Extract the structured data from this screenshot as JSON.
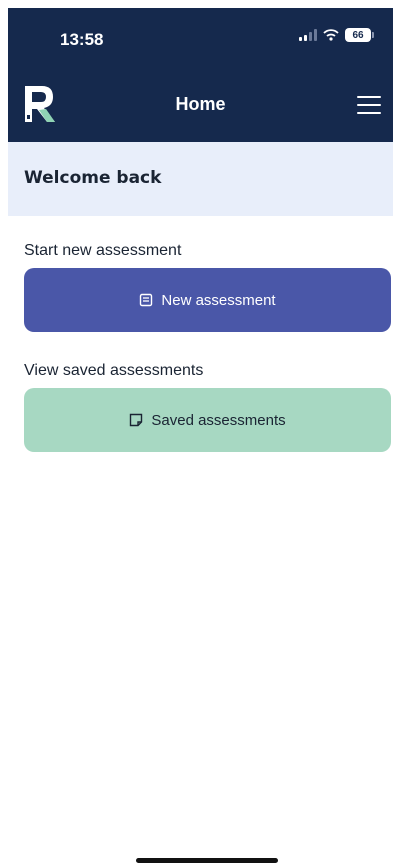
{
  "status_bar": {
    "time": "13:58",
    "battery": "66"
  },
  "header": {
    "title": "Home"
  },
  "welcome": {
    "text": "Welcome back"
  },
  "sections": {
    "new": {
      "label": "Start new assessment",
      "button_label": "New assessment"
    },
    "saved": {
      "label": "View saved assessments",
      "button_label": "Saved assessments"
    }
  },
  "colors": {
    "header_bg": "#15294d",
    "welcome_bg": "#e8eefa",
    "primary_button": "#4a57a8",
    "secondary_button": "#a7d8c2",
    "logo_accent": "#8fd3b4"
  },
  "icons": {
    "logo": "app-logo-r",
    "menu": "hamburger-icon",
    "new_assessment": "document-icon",
    "saved_assessments": "note-icon"
  }
}
